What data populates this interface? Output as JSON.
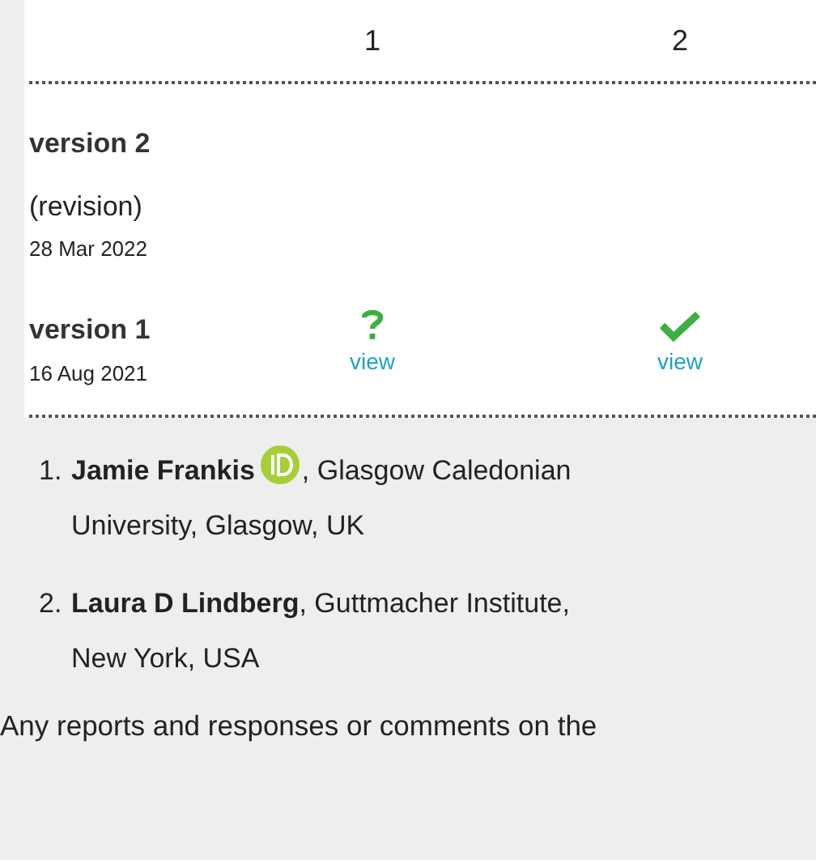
{
  "table": {
    "columns": [
      "1",
      "2"
    ],
    "versions": [
      {
        "title": "version 2",
        "subtitle": "(revision)",
        "date": "28 Mar 2022"
      },
      {
        "title": "version 1",
        "date": "16 Aug 2021",
        "reports": [
          {
            "kind": "question",
            "link": "view"
          },
          {
            "kind": "approved",
            "link": "view"
          }
        ]
      }
    ]
  },
  "reviewers": [
    {
      "number": "1.",
      "name": "Jamie Frankis",
      "orcid": true,
      "affiliation": ", Glasgow Caledonian University, Glasgow, UK"
    },
    {
      "number": "2.",
      "name": "Laura D Lindberg",
      "orcid": false,
      "affiliation": ", Guttmacher Institute, New York, USA"
    }
  ],
  "footer": "Any reports and responses or comments on the"
}
